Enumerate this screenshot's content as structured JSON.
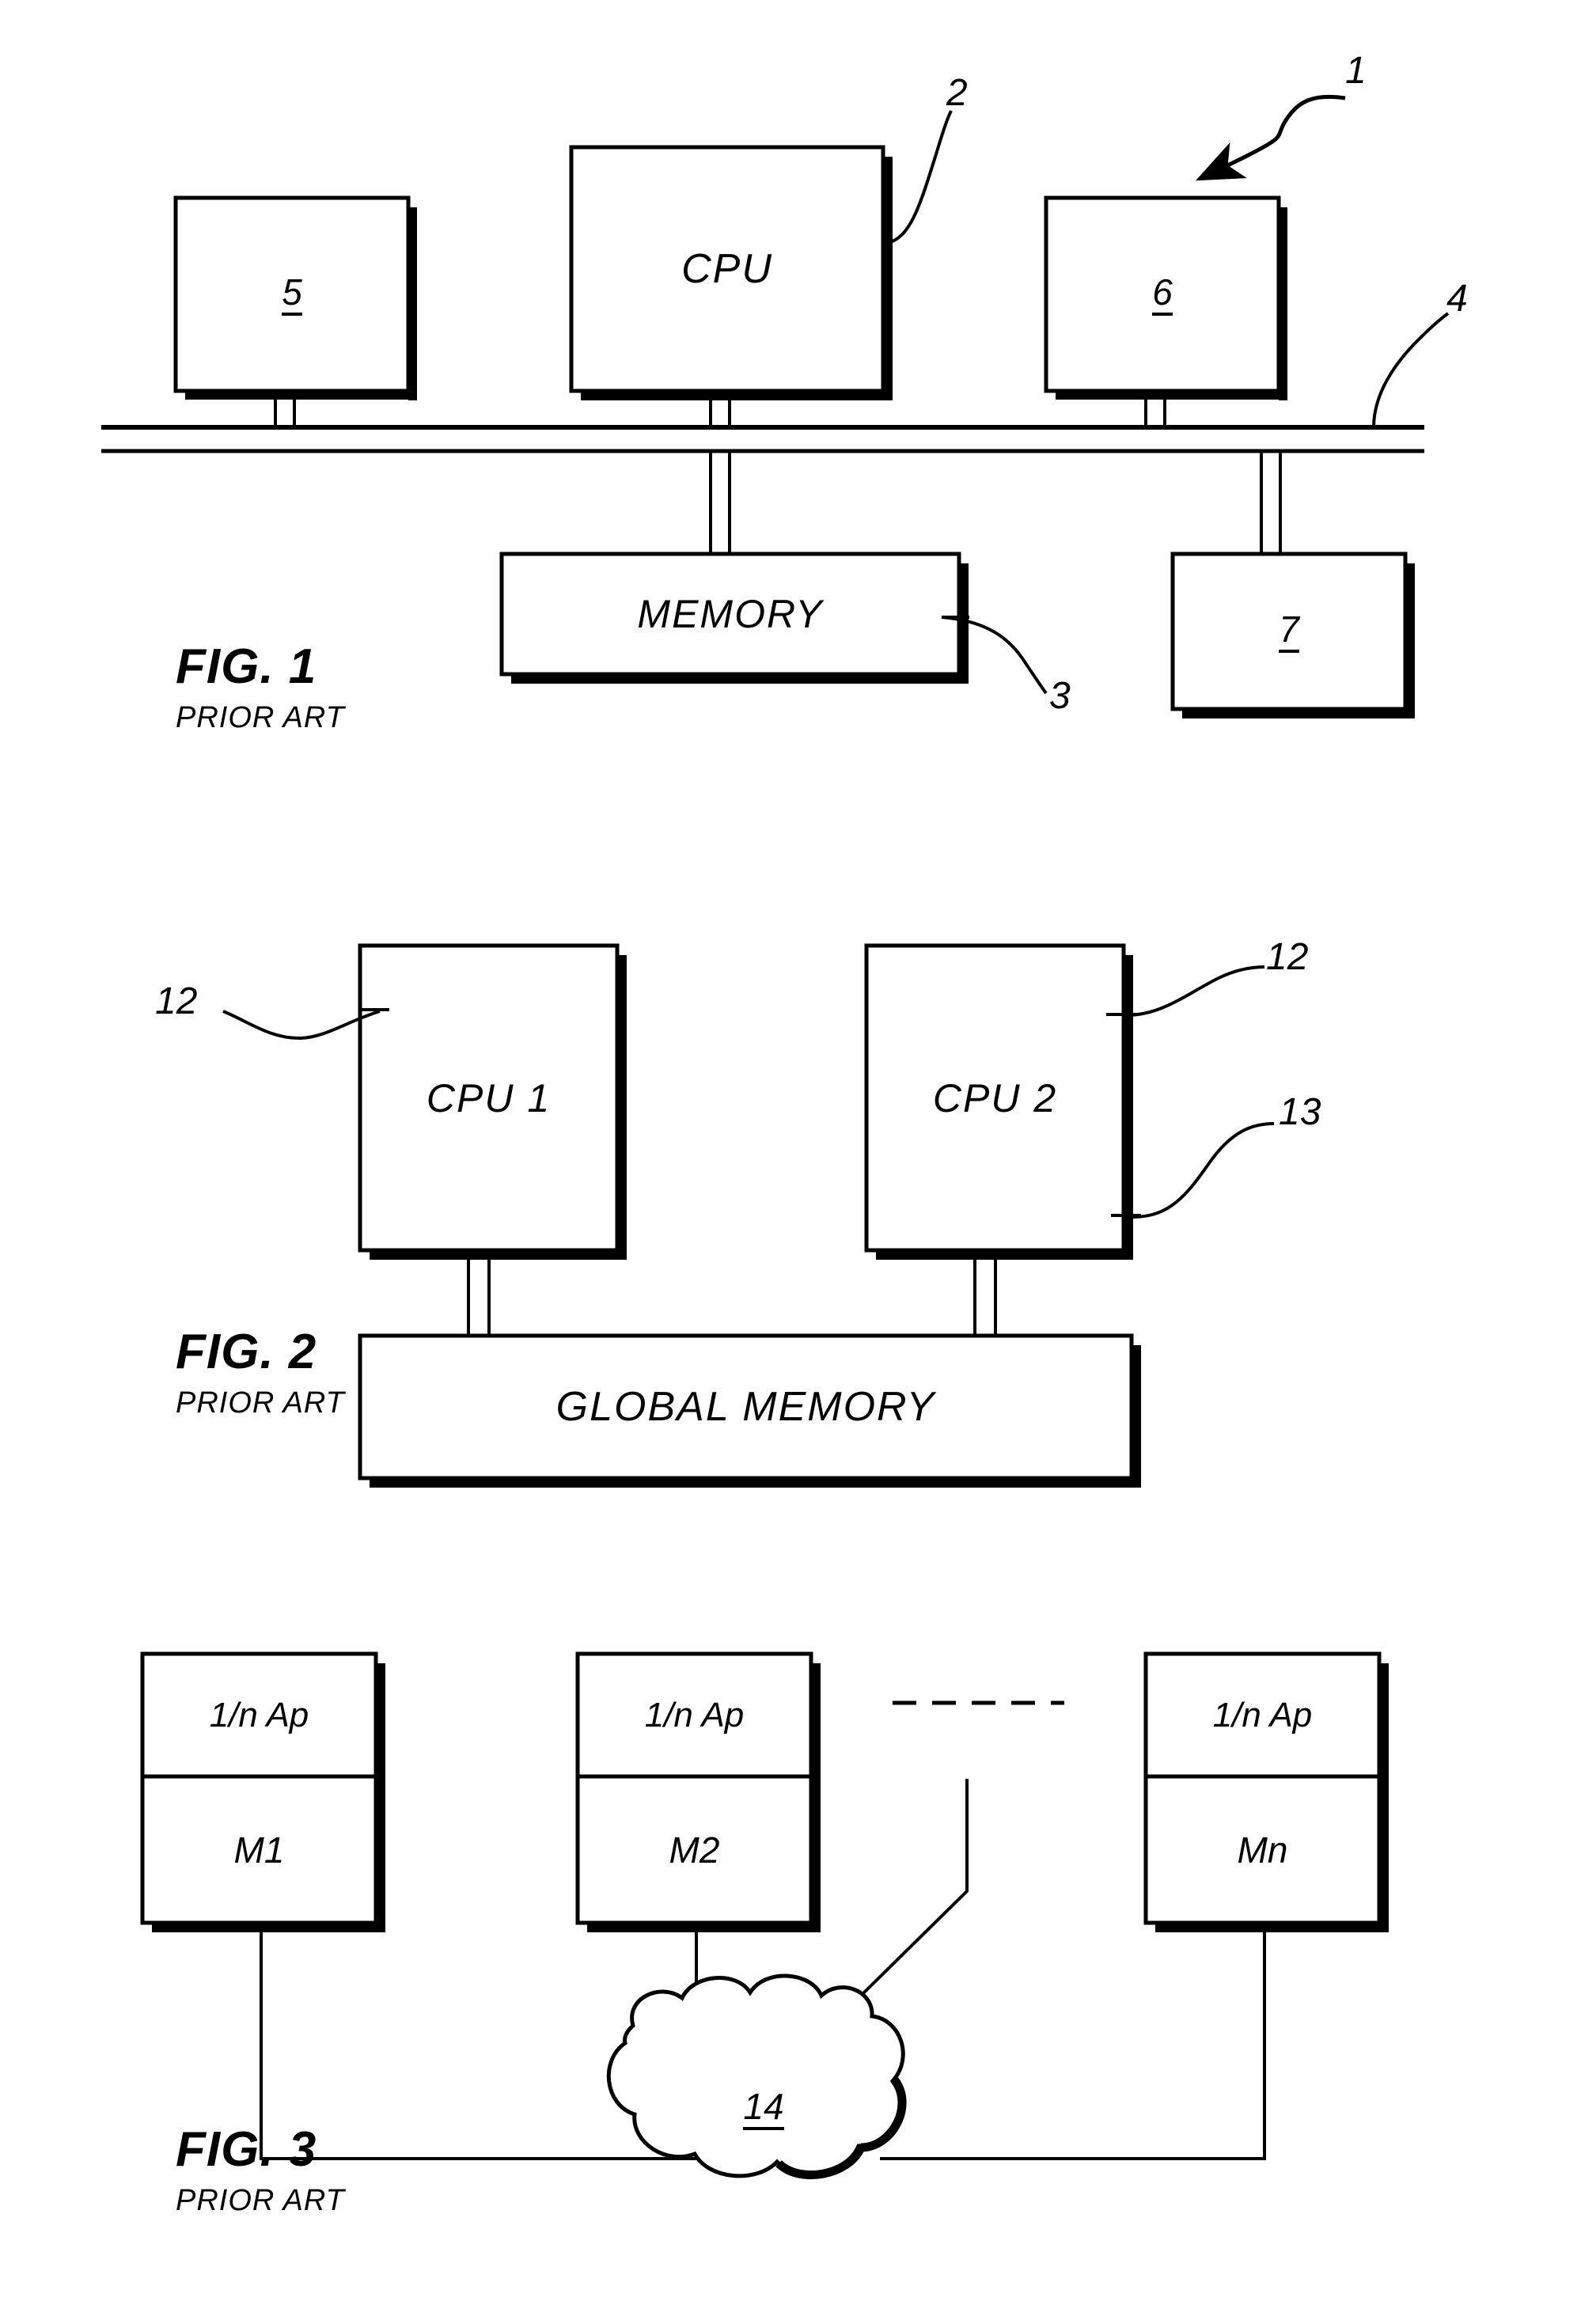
{
  "document": {
    "type": "patent-drawing-sheet",
    "background": "#ffffff",
    "ink": "#000000"
  },
  "figures": [
    {
      "id": "fig1",
      "title": "FIG. 1",
      "subtitle": "PRIOR ART",
      "blocks": [
        {
          "name": "peripheral-5",
          "label": "5",
          "underlined": true
        },
        {
          "name": "cpu",
          "label": "CPU",
          "underlined": false
        },
        {
          "name": "peripheral-6",
          "label": "6",
          "underlined": true
        },
        {
          "name": "memory",
          "label": "MEMORY",
          "underlined": false
        },
        {
          "name": "peripheral-7",
          "label": "7",
          "underlined": true
        }
      ],
      "reference_numerals": [
        {
          "name": "ref-1",
          "label": "1"
        },
        {
          "name": "ref-2",
          "label": "2"
        },
        {
          "name": "ref-3",
          "label": "3"
        },
        {
          "name": "ref-4",
          "label": "4"
        }
      ]
    },
    {
      "id": "fig2",
      "title": "FIG. 2",
      "subtitle": "PRIOR ART",
      "blocks": [
        {
          "name": "cpu-1",
          "label": "CPU 1"
        },
        {
          "name": "cpu-2",
          "label": "CPU 2"
        },
        {
          "name": "global-memory",
          "label": "GLOBAL MEMORY"
        }
      ],
      "reference_numerals": [
        {
          "name": "ref-12-left",
          "label": "12"
        },
        {
          "name": "ref-12-right",
          "label": "12"
        },
        {
          "name": "ref-13",
          "label": "13"
        }
      ]
    },
    {
      "id": "fig3",
      "title": "FIG. 3",
      "subtitle": "PRIOR ART",
      "modules": [
        {
          "name": "module-m1",
          "top": "1/n Ap",
          "bottom": "M1"
        },
        {
          "name": "module-m2",
          "top": "1/n Ap",
          "bottom": "M2"
        },
        {
          "name": "module-mn",
          "top": "1/n Ap",
          "bottom": "Mn"
        }
      ],
      "network": {
        "name": "network-cloud",
        "label": "14",
        "underlined": true
      },
      "ellipsis": "dashed-continuation"
    }
  ]
}
